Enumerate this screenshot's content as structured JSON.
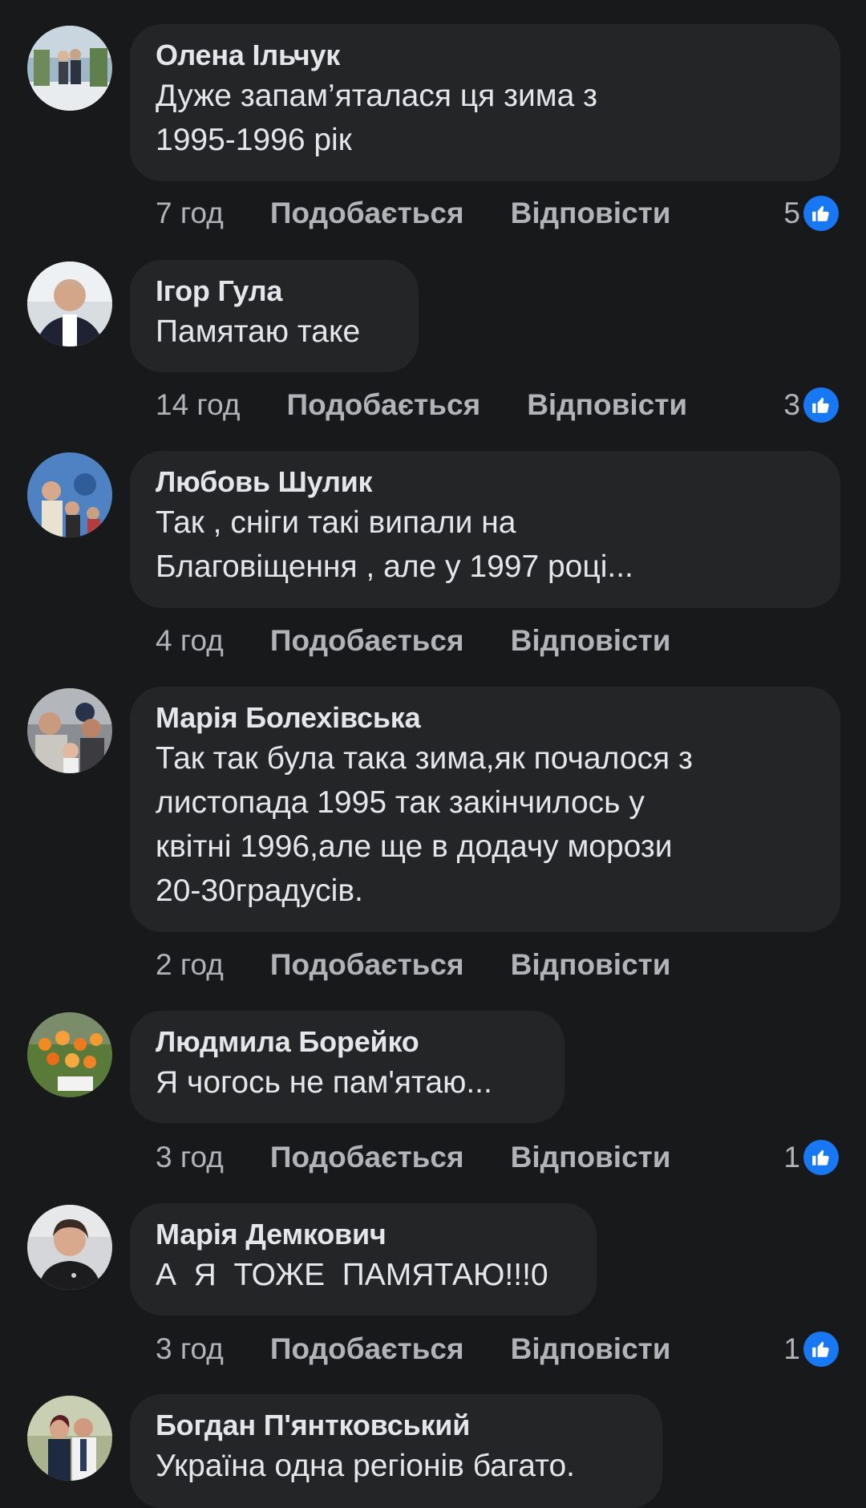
{
  "colors": {
    "background": "#18191a",
    "bubble": "#242526",
    "text": "#e4e6eb",
    "muted": "#b0b3b8",
    "like": "#1877f2"
  },
  "comments": [
    {
      "author": "Олена Ільчук",
      "text": "Дуже запам’яталася ця зима з\n1995-1996 рік",
      "time": "7 год",
      "like_label": "Подобається",
      "reply_label": "Відповісти",
      "likes": "5"
    },
    {
      "author": "Ігор Гула",
      "text": "Памятаю таке",
      "time": "14 год",
      "like_label": "Подобається",
      "reply_label": "Відповісти",
      "likes": "3"
    },
    {
      "author": "Любовь Шулик",
      "text": "Так , сніги такі випали на\nБлаговіщення , але у 1997 році...",
      "time": "4 год",
      "like_label": "Подобається",
      "reply_label": "Відповісти",
      "likes": ""
    },
    {
      "author": "Марія Болехівська",
      "text": "Так так була така зима,як почалося з\nлистопада 1995 так закінчилось у\nквітні 1996,але ще в додачу морози\n20-30градусів.",
      "time": "2 год",
      "like_label": "Подобається",
      "reply_label": "Відповісти",
      "likes": ""
    },
    {
      "author": "Людмила Борейко",
      "text": "Я чогось не пам'ятаю...",
      "time": "3 год",
      "like_label": "Подобається",
      "reply_label": "Відповісти",
      "likes": "1"
    },
    {
      "author": "Марія Демкович",
      "text": "А  Я  ТОЖЕ  ПАМЯТАЮ!!!0",
      "time": "3 год",
      "like_label": "Подобається",
      "reply_label": "Відповісти",
      "likes": "1"
    },
    {
      "author": "Богдан П'янтковський",
      "text": "Україна одна регіонів багато.",
      "time": "",
      "like_label": "",
      "reply_label": "",
      "likes": ""
    }
  ]
}
